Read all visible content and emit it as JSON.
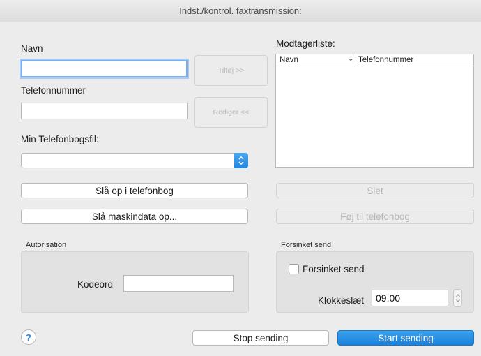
{
  "window": {
    "title": "Indst./kontrol. faxtransmission:"
  },
  "left": {
    "name_label": "Navn",
    "name_value": "",
    "phone_label": "Telefonnummer",
    "phone_value": "",
    "add_button": "Tilføj >>",
    "edit_button": "Rediger <<",
    "phonebook_file_label": "Min Telefonbogsfil:",
    "phonebook_file_value": "",
    "lookup_phonebook_button": "Slå op i telefonbog",
    "lookup_machine_button": "Slå maskindata op..."
  },
  "right": {
    "recipients_label": "Modtagerliste:",
    "list_columns": [
      "Navn",
      "Telefonnummer"
    ],
    "delete_button": "Slet",
    "add_to_phonebook_button": "Føj til telefonbog"
  },
  "authorization": {
    "section_label": "Autorisation",
    "password_label": "Kodeord",
    "password_value": ""
  },
  "delayed": {
    "section_label": "Forsinket send",
    "checkbox_label": "Forsinket send",
    "checked": false,
    "time_label": "Klokkeslæt",
    "time_value": "09.00"
  },
  "footer": {
    "help": "?",
    "stop_button": "Stop sending",
    "start_button": "Start sending"
  },
  "colors": {
    "accent": "#1f86e0",
    "focus_ring": "#7aaeea",
    "background": "#ececec"
  }
}
